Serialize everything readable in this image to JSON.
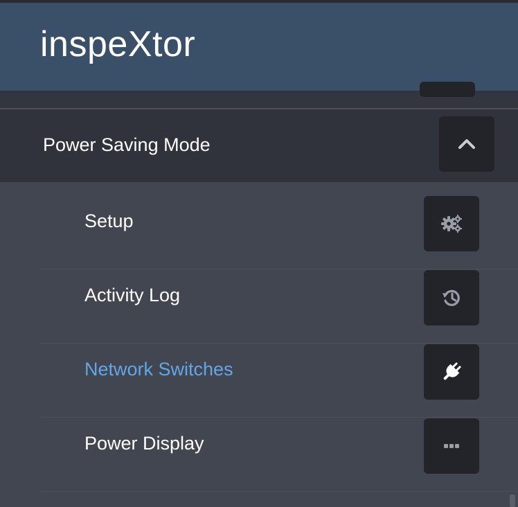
{
  "app": {
    "brand": "inspeXtor"
  },
  "section": {
    "title": "Power Saving Mode",
    "toggle_icon": "chevron-up-icon",
    "expanded": true
  },
  "menu": {
    "items": [
      {
        "label": "Setup",
        "icon": "gears-icon",
        "active": false
      },
      {
        "label": "Activity Log",
        "icon": "history-icon",
        "active": false
      },
      {
        "label": "Network Switches",
        "icon": "plug-icon",
        "active": true
      },
      {
        "label": "Power Display",
        "icon": "ellipsis-icon",
        "active": false
      }
    ]
  },
  "colors": {
    "header_bg": "#3a5068",
    "section_bg": "#30333c",
    "submenu_bg": "#424650",
    "tile_bg": "#22242a",
    "active_text": "#63a6e8"
  }
}
